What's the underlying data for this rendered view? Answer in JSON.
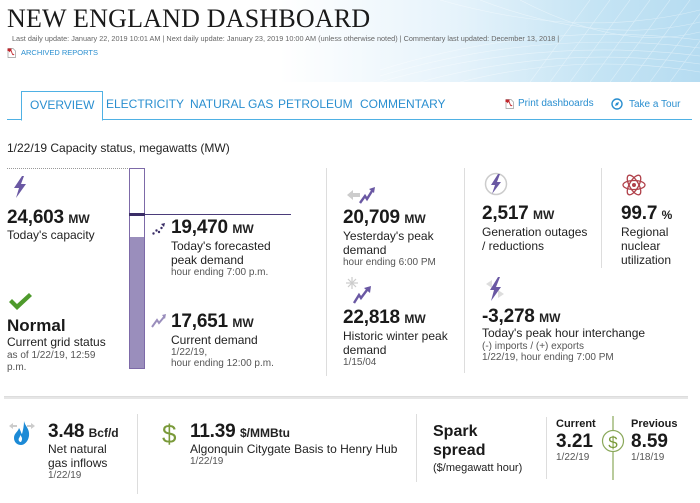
{
  "header": {
    "title": "NEW ENGLAND DASHBOARD",
    "updates": "Last daily update: January 22, 2019 10:01 AM  |  Next daily update: January 23, 2019 10:00 AM (unless otherwise noted) |  Commentary last updated: December 13, 2018 |",
    "archived_label": "ARCHIVED REPORTS"
  },
  "tabs": [
    {
      "label": "OVERVIEW",
      "active": true
    },
    {
      "label": "ELECTRICITY",
      "active": false
    },
    {
      "label": "NATURAL GAS",
      "active": false
    },
    {
      "label": "PETROLEUM",
      "active": false
    },
    {
      "label": "COMMENTARY",
      "active": false
    }
  ],
  "tools": {
    "print_label": "Print dashboards",
    "tour_label": "Take a Tour"
  },
  "section_title": "1/22/19 Capacity status, megawatts (MW)",
  "capacity_bar": {
    "capacity_mw": 24603,
    "forecast_peak_mw": 19470,
    "current_demand_mw": 17651
  },
  "metrics": {
    "capacity": {
      "value": "24,603",
      "unit": "MW",
      "label": "Today's capacity",
      "icon": "lightning-icon"
    },
    "grid_status": {
      "value": "Normal",
      "label": "Current grid status",
      "sub": "as of 1/22/19, 12:59 p.m.",
      "icon": "checkmark-icon"
    },
    "forecast": {
      "value": "19,470",
      "unit": "MW",
      "label1": "Today's forecasted",
      "label2": "peak demand",
      "sub": "hour ending 7:00 p.m.",
      "icon": "forecast-trend-icon"
    },
    "current_demand": {
      "value": "17,651",
      "unit": "MW",
      "label": "Current demand",
      "sub1": "1/22/19,",
      "sub2": "hour ending 12:00 p.m.",
      "icon": "trend-up-icon"
    },
    "yesterday_peak": {
      "value": "20,709",
      "unit": "MW",
      "label1": "Yesterday's peak",
      "label2": "demand",
      "sub": "hour ending 6:00 PM",
      "icon": "yesterday-trend-icon"
    },
    "winter_peak": {
      "value": "22,818",
      "unit": "MW",
      "label1": "Historic winter peak",
      "label2": "demand",
      "sub": "1/15/04",
      "icon": "snowflake-trend-icon"
    },
    "outages": {
      "value": "2,517",
      "unit": "MW",
      "label1": "Generation outages",
      "label2": "/ reductions",
      "icon": "outage-icon"
    },
    "nuclear": {
      "value": "99.7",
      "unit": "%",
      "label1": "Regional",
      "label2": "nuclear",
      "label3": "utilization",
      "icon": "atom-icon"
    },
    "interchange": {
      "value": "-3,278",
      "unit": "MW",
      "label": "Today's peak hour interchange",
      "sub1": "(-) imports / (+) exports",
      "sub2": "1/22/19, hour ending 7:00 PM",
      "icon": "interchange-icon"
    }
  },
  "bottom": {
    "gas_inflows": {
      "value": "3.48",
      "unit": "Bcf/d",
      "label1": "Net natural",
      "label2": "gas inflows",
      "sub": "1/22/19",
      "icon": "gas-flame-icon"
    },
    "algonquin": {
      "value": "11.39",
      "unit": "$/MMBtu",
      "label": "Algonquin Citygate Basis to Henry Hub",
      "sub": "1/22/19",
      "icon": "dollar-icon"
    },
    "spark": {
      "title1": "Spark",
      "title2": "spread",
      "sub": "($/megawatt hour)",
      "current_label": "Current",
      "current_value": "3.21",
      "current_date": "1/22/19",
      "previous_label": "Previous",
      "previous_value": "8.59",
      "previous_date": "1/18/19",
      "icon": "dollar-circle-icon"
    }
  },
  "colors": {
    "accent_blue": "#2a8fd0",
    "tab_border": "#4fb1e4",
    "purple": "#6a58a3",
    "bar_fill": "#9a8ebc",
    "green_check": "#4e9a2c",
    "dollar_green": "#7a9a3a",
    "nuclear_red": "#b0414a",
    "flame_blue": "#1c8ad6"
  }
}
